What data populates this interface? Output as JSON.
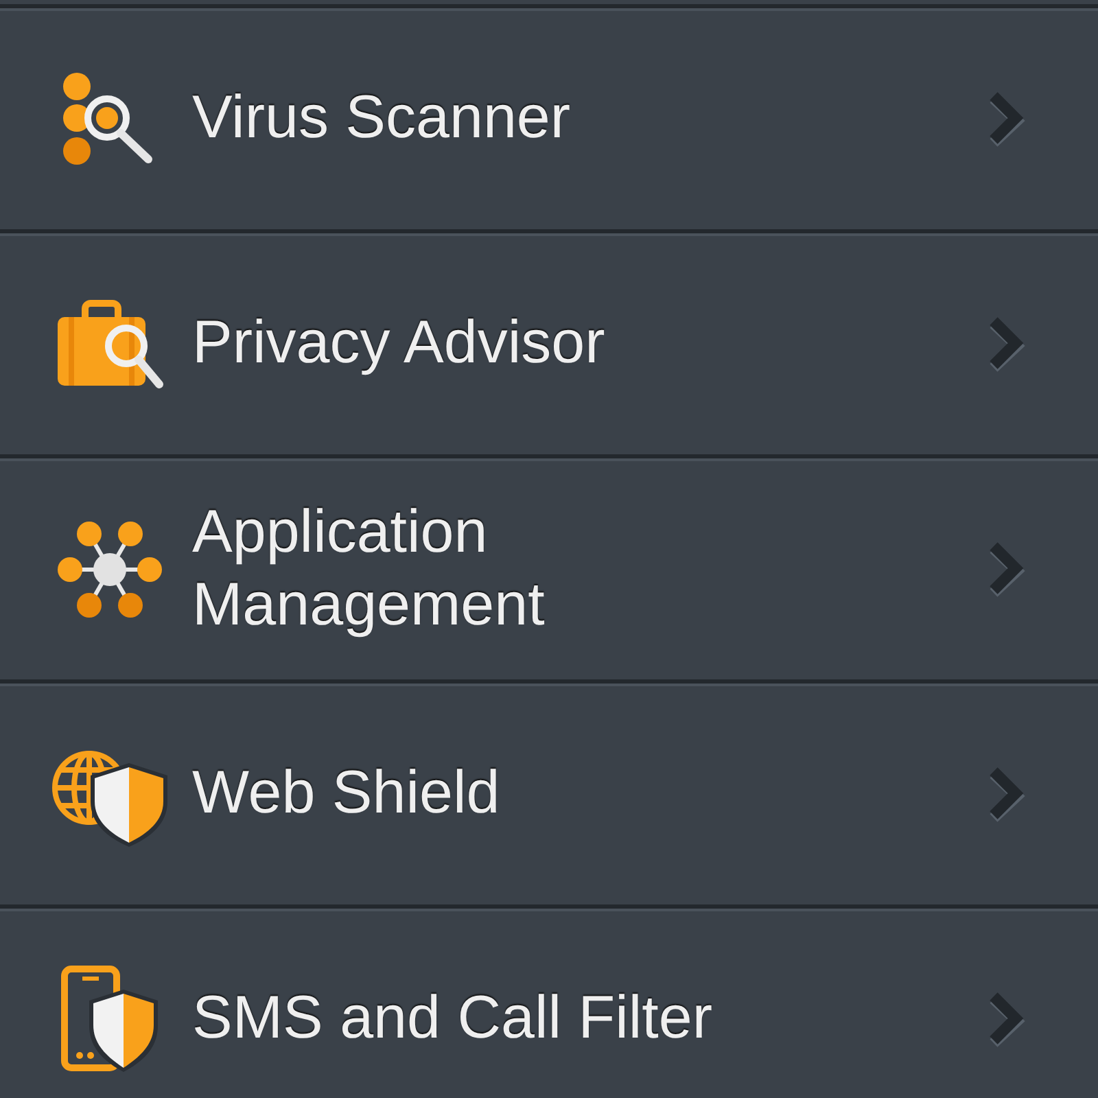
{
  "menu": {
    "items": [
      {
        "kind": "virus_scanner",
        "label": "Virus Scanner"
      },
      {
        "kind": "privacy_advisor",
        "label": "Privacy Advisor"
      },
      {
        "kind": "application_management",
        "label": "Application Management"
      },
      {
        "kind": "web_shield",
        "label": "Web Shield"
      },
      {
        "kind": "sms_call_filter",
        "label": "SMS and Call Filter"
      }
    ]
  }
}
